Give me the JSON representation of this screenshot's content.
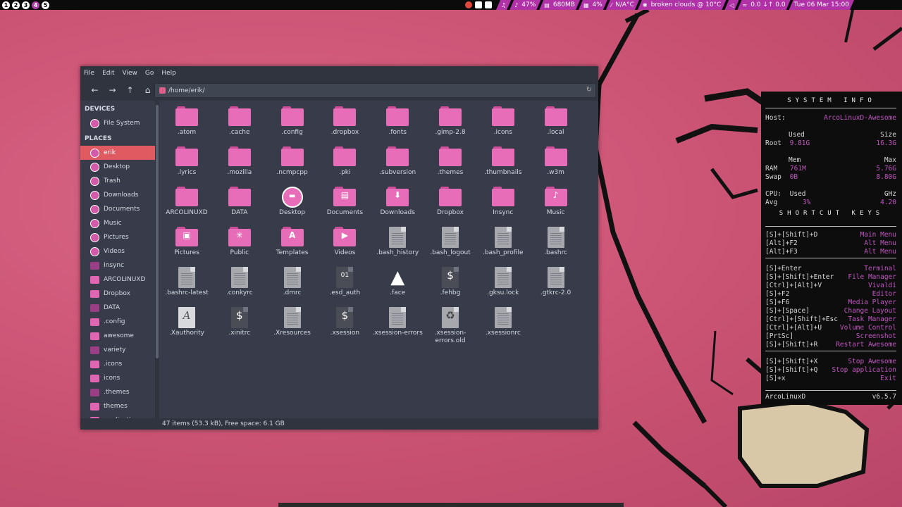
{
  "topbar": {
    "tags": [
      "1",
      "2",
      "3",
      "4",
      "5"
    ],
    "active_tag": 3,
    "widgets": [
      {
        "icon": "music-icon",
        "glyph": "♫",
        "text": ""
      },
      {
        "icon": "volume-icon",
        "glyph": "🔊",
        "text": "47%"
      },
      {
        "icon": "memory-icon",
        "glyph": "▤",
        "text": "680MB"
      },
      {
        "icon": "cpu-icon",
        "glyph": "▦",
        "text": "4%"
      },
      {
        "icon": "temperature-icon",
        "glyph": "🌡",
        "text": "N/A°C"
      },
      {
        "icon": "weather-icon",
        "glyph": "☁",
        "text": "broken clouds @ 10°C"
      },
      {
        "icon": "speaker-icon",
        "glyph": "◁",
        "text": ""
      },
      {
        "icon": "network-icon",
        "glyph": "⇅",
        "text": "0.0 ↓↑ 0.0"
      },
      {
        "icon": "clock-icon",
        "glyph": "",
        "text": "Tue 06 Mar 15:00"
      }
    ]
  },
  "window": {
    "menu": [
      "File",
      "Edit",
      "View",
      "Go",
      "Help"
    ],
    "path": "/home/erik/",
    "sidebar": {
      "devices_title": "DEVICES",
      "devices": [
        {
          "label": "File System",
          "icon": "drive-icon"
        }
      ],
      "places_title": "PLACES",
      "places": [
        {
          "label": "erik",
          "icon": "home-icon",
          "selected": true
        },
        {
          "label": "Desktop",
          "icon": "desktop-icon"
        },
        {
          "label": "Trash",
          "icon": "trash-icon"
        },
        {
          "label": "Downloads",
          "icon": "downloads-icon"
        },
        {
          "label": "Documents",
          "icon": "documents-icon"
        },
        {
          "label": "Music",
          "icon": "music-icon"
        },
        {
          "label": "Pictures",
          "icon": "pictures-icon"
        },
        {
          "label": "Videos",
          "icon": "videos-icon"
        },
        {
          "label": "Insync",
          "icon": "folder-icon"
        },
        {
          "label": "ARCOLINUXD",
          "icon": "folder-icon"
        },
        {
          "label": "Dropbox",
          "icon": "folder-icon"
        },
        {
          "label": "DATA",
          "icon": "folder-icon"
        },
        {
          "label": ".config",
          "icon": "folder-icon"
        },
        {
          "label": "awesome",
          "icon": "folder-icon"
        },
        {
          "label": "variety",
          "icon": "folder-icon"
        },
        {
          "label": ".icons",
          "icon": "folder-icon"
        },
        {
          "label": "icons",
          "icon": "folder-icon"
        },
        {
          "label": ".themes",
          "icon": "folder-icon"
        },
        {
          "label": "themes",
          "icon": "folder-icon"
        },
        {
          "label": "applications",
          "icon": "folder-icon"
        }
      ]
    },
    "files": [
      {
        "name": ".atom",
        "kind": "folder"
      },
      {
        "name": ".cache",
        "kind": "folder"
      },
      {
        "name": ".config",
        "kind": "folder"
      },
      {
        "name": ".dropbox",
        "kind": "folder"
      },
      {
        "name": ".fonts",
        "kind": "folder"
      },
      {
        "name": ".gimp-2.8",
        "kind": "folder"
      },
      {
        "name": ".icons",
        "kind": "folder"
      },
      {
        "name": ".local",
        "kind": "folder"
      },
      {
        "name": ".lyrics",
        "kind": "folder"
      },
      {
        "name": ".mozilla",
        "kind": "folder"
      },
      {
        "name": ".ncmpcpp",
        "kind": "folder"
      },
      {
        "name": ".pki",
        "kind": "folder"
      },
      {
        "name": ".subversion",
        "kind": "folder"
      },
      {
        "name": ".themes",
        "kind": "folder"
      },
      {
        "name": ".thumbnails",
        "kind": "folder"
      },
      {
        "name": ".w3m",
        "kind": "folder"
      },
      {
        "name": "ARCOLINUXD",
        "kind": "folder"
      },
      {
        "name": "DATA",
        "kind": "folder"
      },
      {
        "name": "Desktop",
        "kind": "desktop"
      },
      {
        "name": "Documents",
        "kind": "folder",
        "glyph": "▤"
      },
      {
        "name": "Downloads",
        "kind": "folder",
        "glyph": "⬇"
      },
      {
        "name": "Dropbox",
        "kind": "folder"
      },
      {
        "name": "Insync",
        "kind": "folder"
      },
      {
        "name": "Music",
        "kind": "folder",
        "glyph": "♪"
      },
      {
        "name": "Pictures",
        "kind": "folder",
        "glyph": "▣"
      },
      {
        "name": "Public",
        "kind": "folder",
        "glyph": "✳"
      },
      {
        "name": "Templates",
        "kind": "folder",
        "glyph": "A"
      },
      {
        "name": "Videos",
        "kind": "folder",
        "glyph": "▶"
      },
      {
        "name": ".bash_history",
        "kind": "doc"
      },
      {
        "name": ".bash_logout",
        "kind": "doc"
      },
      {
        "name": ".bash_profile",
        "kind": "doc"
      },
      {
        "name": ".bashrc",
        "kind": "doc"
      },
      {
        "name": ".bashrc-latest",
        "kind": "doc"
      },
      {
        "name": ".conkyrc",
        "kind": "doc"
      },
      {
        "name": ".dmrc",
        "kind": "doc"
      },
      {
        "name": ".esd_auth",
        "kind": "binary",
        "glyph": "01"
      },
      {
        "name": ".face",
        "kind": "arch",
        "glyph": "▲"
      },
      {
        "name": ".fehbg",
        "kind": "script",
        "glyph": "$"
      },
      {
        "name": ".gksu.lock",
        "kind": "doc"
      },
      {
        "name": ".gtkrc-2.0",
        "kind": "doc"
      },
      {
        "name": ".Xauthority",
        "kind": "xauth",
        "glyph": "A"
      },
      {
        "name": ".xinitrc",
        "kind": "script",
        "glyph": "$"
      },
      {
        "name": ".Xresources",
        "kind": "doc"
      },
      {
        "name": ".xsession",
        "kind": "script",
        "glyph": "$"
      },
      {
        "name": ".xsession-errors",
        "kind": "doc"
      },
      {
        "name": ".xsession-errors.old",
        "kind": "recycle",
        "glyph": "♻"
      },
      {
        "name": ".xsessionrc",
        "kind": "doc"
      }
    ],
    "status": "47 items (53.3 kB), Free space: 6.1 GB"
  },
  "conky": {
    "title": "SYSTEM INFO",
    "host_label": "Host:",
    "host": "ArcoLinuxD-Awesome",
    "disk_used_hdr": "Used",
    "disk_size_hdr": "Size",
    "root_label": "Root",
    "root_used": "9.81G",
    "root_size": "16.3G",
    "mem_hdr": "Mem",
    "max_hdr": "Max",
    "ram_label": "RAM",
    "ram_used": "761M",
    "ram_max": "5.76G",
    "swap_label": "Swap",
    "swap_used": "0B",
    "swap_max": "8.80G",
    "cpu_label": "CPU:",
    "cpu_used_hdr": "Used",
    "ghz_hdr": "GHz",
    "avg_label": "Avg",
    "avg_used": "3%",
    "avg_ghz": "4.20",
    "shortcuts_title": "SHORTCUT KEYS",
    "shortcuts": [
      {
        "key": "[S]+[Shift]+D",
        "action": "Main Menu"
      },
      {
        "key": "[Alt]+F2",
        "action": "Alt Menu"
      },
      {
        "key": "[Alt]+F3",
        "action": "Alt Menu"
      },
      {
        "key": "[S]+Enter",
        "action": "Terminal"
      },
      {
        "key": "[S]+[Shift]+Enter",
        "action": "File Manager"
      },
      {
        "key": "[Ctrl]+[Alt]+V",
        "action": "Vivaldi"
      },
      {
        "key": "[S]+F2",
        "action": "Editor"
      },
      {
        "key": "[S]+F6",
        "action": "Media Player"
      },
      {
        "key": "[S]+[Space]",
        "action": "Change Layout"
      },
      {
        "key": "[Ctrl]+[Shift]+Esc",
        "action": "Task Manager"
      },
      {
        "key": "[Ctrl]+[Alt]+U",
        "action": "Volume Control"
      },
      {
        "key": "[PrtSc]",
        "action": "Screenshot"
      },
      {
        "key": "[S]+[Shift]+R",
        "action": "Restart Awesome"
      },
      {
        "key": "[S]+[Shift]+X",
        "action": "Stop Awesome"
      },
      {
        "key": "[S]+[Shift]+Q",
        "action": "Stop application"
      },
      {
        "key": "[S]+x",
        "action": "Exit"
      }
    ],
    "footer_left": "ArcoLinuxD",
    "footer_right": "v6.5.7"
  }
}
